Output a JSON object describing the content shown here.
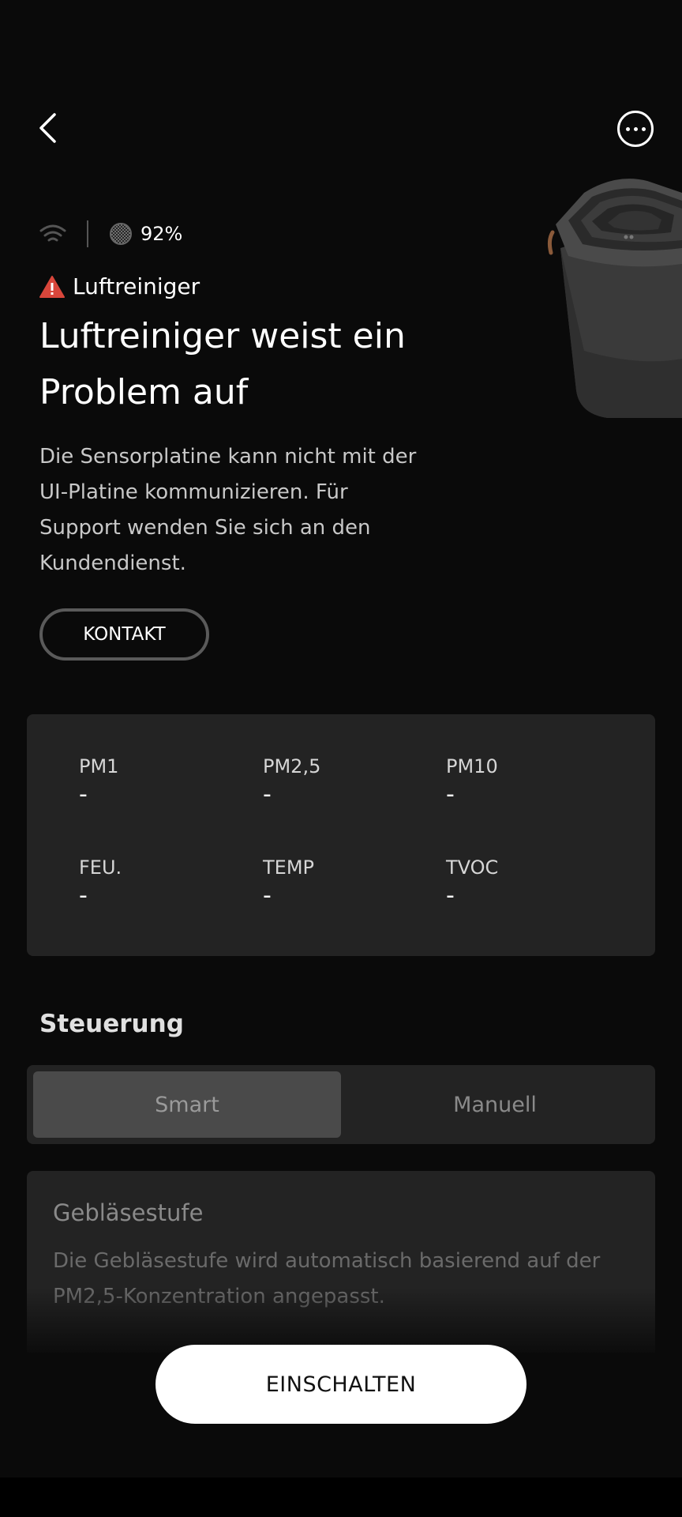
{
  "header": {
    "back_icon": "chevron-left-icon",
    "more_icon": "more-horizontal-icon"
  },
  "status": {
    "wifi_icon": "wifi-icon",
    "filter_icon": "filter-icon",
    "filter_life": "92%"
  },
  "alert": {
    "icon": "warning-triangle-icon",
    "icon_color": "#d9463b",
    "device_name": "Luftreiniger",
    "title": "Luftreiniger weist ein Problem auf",
    "description": "Die Sensorplatine kann nicht mit der UI-Platine kommunizieren. Für Support wenden Sie sich an den Kundendienst.",
    "contact_label": "KONTAKT"
  },
  "readings": [
    {
      "label": "PM1",
      "value": "-"
    },
    {
      "label": "PM2,5",
      "value": "-"
    },
    {
      "label": "PM10",
      "value": "-"
    },
    {
      "label": "FEU.",
      "value": "-"
    },
    {
      "label": "TEMP",
      "value": "-"
    },
    {
      "label": "TVOC",
      "value": "-"
    }
  ],
  "control": {
    "title": "Steuerung",
    "modes": [
      "Smart",
      "Manuell"
    ],
    "selected_mode": "Smart"
  },
  "fan": {
    "title": "Gebläsestufe",
    "description": "Die Gebläsestufe wird automatisch basierend auf der PM2,5-Konzentration angepasst."
  },
  "power": {
    "label": "EINSCHALTEN"
  },
  "colors": {
    "background": "#0a0a0a",
    "card": "#232323",
    "primary_button": "#ffffff"
  }
}
